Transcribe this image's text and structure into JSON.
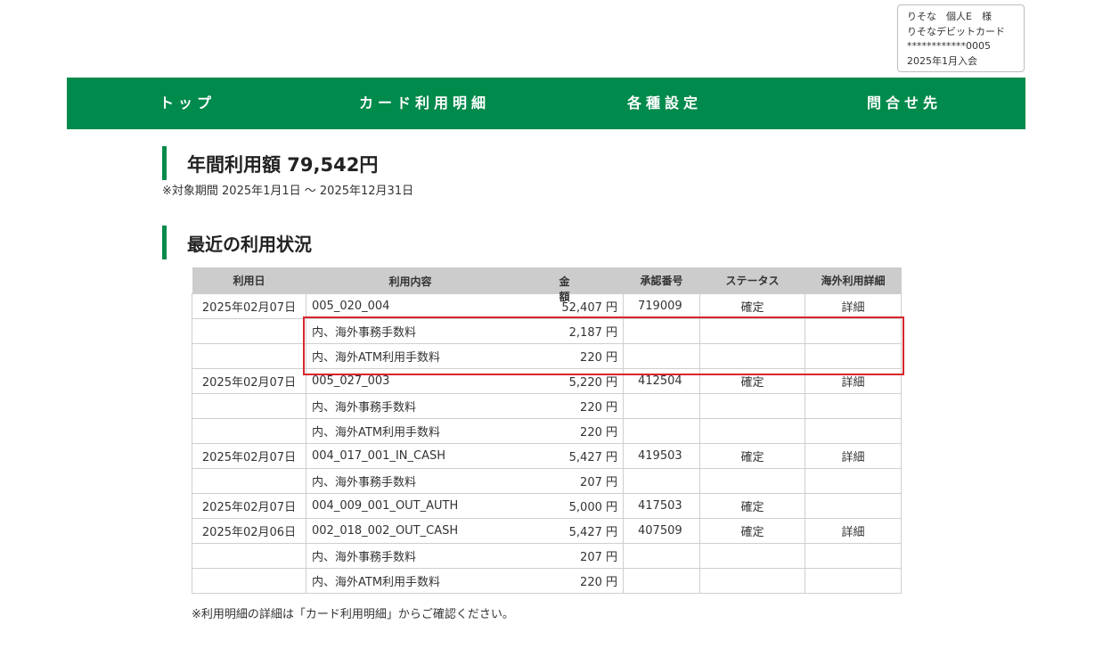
{
  "user": {
    "line1": "りそな　個人E　様",
    "line2": "りそなデビットカード",
    "line3": "************0005",
    "line4": "2025年1月入会"
  },
  "nav": {
    "top": "トップ",
    "statement": "カード利用明細",
    "settings": "各種設定",
    "contact": "問合せ先"
  },
  "annual": {
    "title": "年間利用額 79,542円",
    "period": "※対象期間 2025年1月1日 〜 2025年12月31日"
  },
  "recent": {
    "title": "最近の利用状況",
    "headers": {
      "date": "利用日",
      "content": "利用内容",
      "amount": "金額",
      "approval": "承認番号",
      "status": "ステータス",
      "overseas": "海外利用詳細"
    },
    "rows": [
      {
        "date": "2025年02月07日",
        "content": "005_020_004",
        "amount": "52,407 円",
        "approval": "719009",
        "status": "確定",
        "detail": "詳細"
      },
      {
        "date": "",
        "content": "内、海外事務手数料",
        "amount": "2,187 円",
        "approval": "",
        "status": "",
        "detail": ""
      },
      {
        "date": "",
        "content": "内、海外ATM利用手数料",
        "amount": "220 円",
        "approval": "",
        "status": "",
        "detail": ""
      },
      {
        "date": "2025年02月07日",
        "content": "005_027_003",
        "amount": "5,220 円",
        "approval": "412504",
        "status": "確定",
        "detail": "詳細"
      },
      {
        "date": "",
        "content": "内、海外事務手数料",
        "amount": "220 円",
        "approval": "",
        "status": "",
        "detail": ""
      },
      {
        "date": "",
        "content": "内、海外ATM利用手数料",
        "amount": "220 円",
        "approval": "",
        "status": "",
        "detail": ""
      },
      {
        "date": "2025年02月07日",
        "content": "004_017_001_IN_CASH",
        "amount": "5,427 円",
        "approval": "419503",
        "status": "確定",
        "detail": "詳細"
      },
      {
        "date": "",
        "content": "内、海外事務手数料",
        "amount": "207 円",
        "approval": "",
        "status": "",
        "detail": ""
      },
      {
        "date": "2025年02月07日",
        "content": "004_009_001_OUT_AUTH",
        "amount": "5,000 円",
        "approval": "417503",
        "status": "確定",
        "detail": ""
      },
      {
        "date": "2025年02月06日",
        "content": "002_018_002_OUT_CASH",
        "amount": "5,427 円",
        "approval": "407509",
        "status": "確定",
        "detail": "詳細"
      },
      {
        "date": "",
        "content": "内、海外事務手数料",
        "amount": "207 円",
        "approval": "",
        "status": "",
        "detail": ""
      },
      {
        "date": "",
        "content": "内、海外ATM利用手数料",
        "amount": "220 円",
        "approval": "",
        "status": "",
        "detail": ""
      }
    ],
    "note": "※利用明細の詳細は「カード利用明細」からご確認ください。"
  },
  "colors": {
    "brand_green": "#008a4b",
    "highlight_red": "#d9262c",
    "header_gray": "#cccccc"
  }
}
